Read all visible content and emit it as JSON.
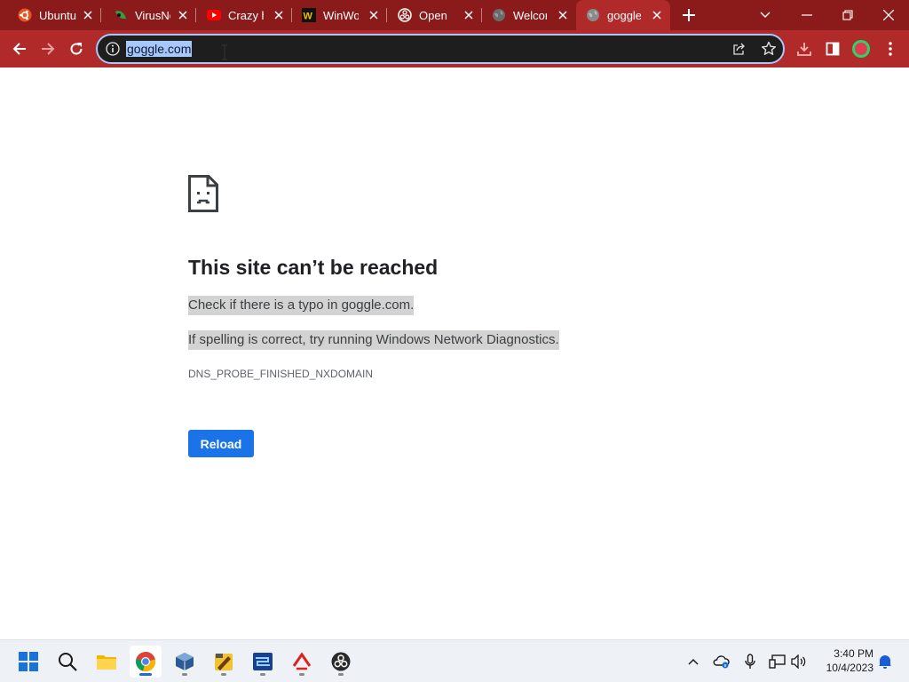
{
  "browser": {
    "tabs": [
      {
        "title": "Ubuntu",
        "icon": "ubuntu-icon"
      },
      {
        "title": "VirusNe",
        "icon": "virusnet-icon"
      },
      {
        "title": "Crazy h",
        "icon": "youtube-icon"
      },
      {
        "title": "WinWo",
        "icon": "winworld-icon"
      },
      {
        "title": "Open B",
        "icon": "obs-icon"
      },
      {
        "title": "Welcor",
        "icon": "globe-icon"
      },
      {
        "title": "goggle",
        "icon": "globe-icon"
      }
    ],
    "active_tab": 6,
    "address": "goggle.com"
  },
  "error_page": {
    "heading": "This site can’t be reached",
    "hint_typo": "Check if there is a typo in goggle.com.",
    "hint_diagnostics": "If spelling is correct, try running Windows Network Diagnostics.",
    "error_code": "DNS_PROBE_FINISHED_NXDOMAIN",
    "reload_label": "Reload"
  },
  "taskbar": {
    "apps": [
      "start-icon",
      "search-icon",
      "file-explorer-icon",
      "chrome-icon",
      "virtualbox-icon",
      "notepad-plus-plus-icon",
      "network-tool-icon",
      "git-tool-icon",
      "obs-icon"
    ],
    "time": "3:40 PM",
    "date": "10/4/2023"
  },
  "colors": {
    "frame": "#8b1a1a",
    "toolbar": "#b02a2a",
    "accent": "#1a73e8",
    "selection": "#a8c7fa"
  }
}
